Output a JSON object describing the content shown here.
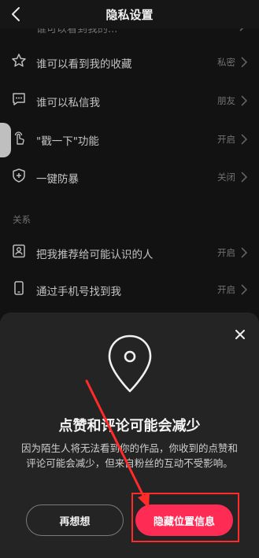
{
  "header": {
    "title": "隐私设置"
  },
  "cut_row": {
    "label": "谁可以看到我的...",
    "value": ""
  },
  "rows": [
    {
      "label": "谁可以看到我的收藏",
      "value": "私密",
      "icon": "star-icon"
    },
    {
      "label": "谁可以私信我",
      "value": "朋友",
      "icon": "chat-bubble-icon"
    },
    {
      "label": "\"戳一下\"功能",
      "value": "开启",
      "icon": "poke-hand-icon"
    },
    {
      "label": "一键防暴",
      "value": "关闭",
      "icon": "shield-plus-icon"
    }
  ],
  "section": {
    "title": "关系"
  },
  "relation_rows": [
    {
      "label": "把我推荐给可能认识的人",
      "value": "开启",
      "icon": "contact-card-icon"
    },
    {
      "label": "通过手机号找到我",
      "value": "开启",
      "icon": "phone-icon"
    }
  ],
  "sheet": {
    "icon": "location-pin-icon",
    "title": "点赞和评论可能会减少",
    "description": "因为陌生人将无法看到你的作品，你收到的点赞和评论可能会减少，但来自粉丝的互动不受影响。",
    "cancel_label": "再想想",
    "confirm_label": "隐藏位置信息"
  },
  "colors": {
    "accent": "#fe2c55",
    "annotation": "#ff2a2a",
    "background": "#161616",
    "sheet": "#242424"
  }
}
